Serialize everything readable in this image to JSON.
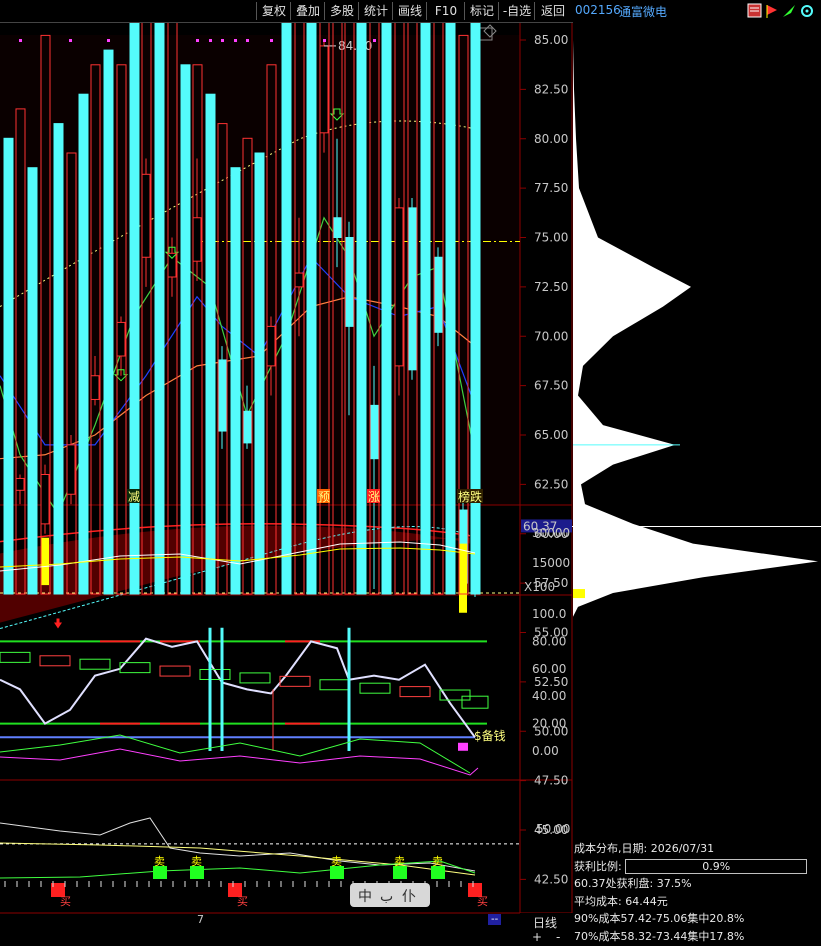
{
  "toolbar": {
    "buttons": [
      "复权",
      "叠加",
      "多股",
      "统计",
      "画线",
      "F10",
      "标记",
      "-自选",
      "返回"
    ]
  },
  "stock": {
    "code": "002156",
    "name": "通富微电"
  },
  "price_axis": {
    "ticks": [
      "85.00",
      "82.50",
      "80.00",
      "77.50",
      "75.00",
      "72.50",
      "70.00",
      "67.50",
      "65.00",
      "62.50",
      "60.00",
      "57.50",
      "55.00",
      "52.50",
      "50.00",
      "47.50",
      "45.00",
      "42.50",
      "40.00"
    ],
    "current_price": "60.37",
    "peak_label": "84.70"
  },
  "volume_axis": {
    "ticks": [
      "30000",
      "15000"
    ],
    "unit": "X100"
  },
  "indicator_axis": {
    "ticks": [
      "100.0",
      "80.00",
      "60.00",
      "40.00",
      "20.00",
      "0.00"
    ],
    "label": "$备钱"
  },
  "bottom_axis": {
    "ticks": [
      "50.00"
    ]
  },
  "signals": {
    "minus": "减",
    "pre": "预",
    "up": "涨",
    "top_fall": "榜跌",
    "sell": "卖",
    "buy": "买"
  },
  "colors": {
    "up": "#ff3232",
    "down": "#54fcfc",
    "ma5": "#ffffff",
    "ma10": "#ffff00",
    "ma20": "#ff00ff",
    "bg": "#000000",
    "grid": "#8b0000"
  },
  "cost_info": {
    "title": "成本分布,日期:",
    "date": "2026/07/31",
    "profit_label": "获利比例:",
    "profit_value": "0.9%",
    "profit_pct": 0.9,
    "line1": "60.37处获利盘: 37.5%",
    "line2": "平均成本: 64.44元",
    "line3": "90%成本57.42-75.06集中20.8%",
    "line4": "70%成本58.32-73.44集中17.8%"
  },
  "bottom": {
    "month": "7",
    "period": "日线",
    "plus": "+",
    "minus": "-",
    "dashes": "--"
  },
  "watermark": [
    "中",
    "ب",
    "仆"
  ]
}
